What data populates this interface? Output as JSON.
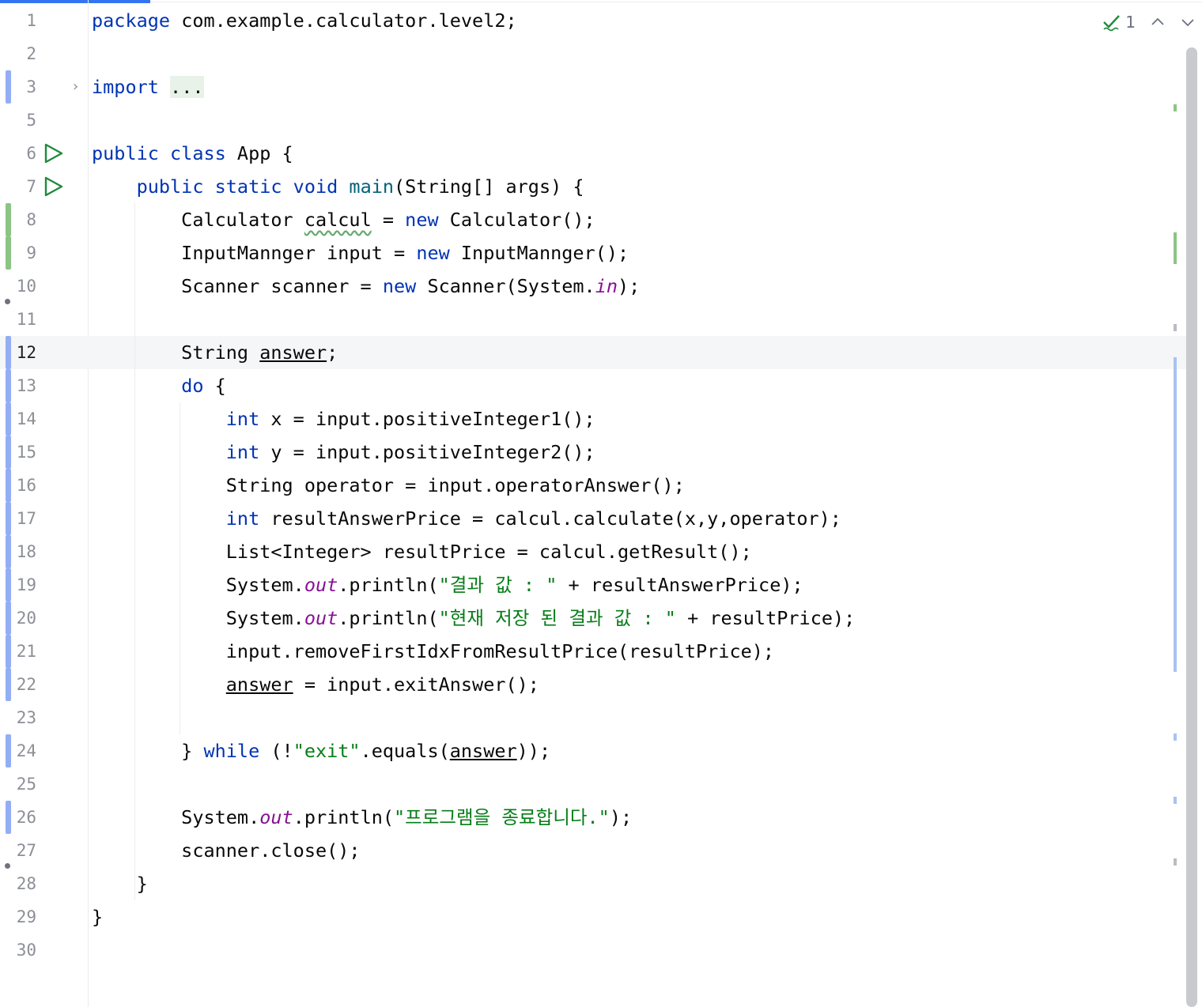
{
  "editor": {
    "lines": [
      {
        "n": "1",
        "tokens": [
          {
            "t": "package",
            "c": "kw"
          },
          {
            "t": " com.example.calculator.level2;",
            "c": "pl"
          }
        ]
      },
      {
        "n": "2",
        "tokens": []
      },
      {
        "n": "3",
        "tokens": [
          {
            "t": "import",
            "c": "kw"
          },
          {
            "t": " ",
            "c": "pl"
          },
          {
            "t": "...",
            "c": "fold"
          }
        ]
      },
      {
        "n": "5",
        "tokens": []
      },
      {
        "n": "6",
        "tokens": [
          {
            "t": "public class",
            "c": "kw"
          },
          {
            "t": " App {",
            "c": "pl"
          }
        ]
      },
      {
        "n": "7",
        "tokens": [
          {
            "t": "    "
          },
          {
            "t": "public static void",
            "c": "kw"
          },
          {
            "t": " "
          },
          {
            "t": "main",
            "c": "fn"
          },
          {
            "t": "(String[] args) {"
          }
        ]
      },
      {
        "n": "8",
        "tokens": [
          {
            "t": "        Calculator "
          },
          {
            "t": "calcul",
            "c": "warn"
          },
          {
            "t": " = "
          },
          {
            "t": "new",
            "c": "kw"
          },
          {
            "t": " Calculator();"
          }
        ]
      },
      {
        "n": "9",
        "tokens": [
          {
            "t": "        InputMannger input = "
          },
          {
            "t": "new",
            "c": "kw"
          },
          {
            "t": " InputMannger();"
          }
        ]
      },
      {
        "n": "10",
        "tokens": [
          {
            "t": "        Scanner scanner = "
          },
          {
            "t": "new",
            "c": "kw"
          },
          {
            "t": " Scanner(System."
          },
          {
            "t": "in",
            "c": "st"
          },
          {
            "t": ");"
          }
        ]
      },
      {
        "n": "11",
        "tokens": []
      },
      {
        "n": "12",
        "tokens": [
          {
            "t": "        String "
          },
          {
            "t": "answer",
            "c": "und"
          },
          {
            "t": ";"
          }
        ]
      },
      {
        "n": "13",
        "tokens": [
          {
            "t": "        "
          },
          {
            "t": "do",
            "c": "kw"
          },
          {
            "t": " {"
          }
        ]
      },
      {
        "n": "14",
        "tokens": [
          {
            "t": "            "
          },
          {
            "t": "int",
            "c": "kw"
          },
          {
            "t": " x = input.positiveInteger1();"
          }
        ]
      },
      {
        "n": "15",
        "tokens": [
          {
            "t": "            "
          },
          {
            "t": "int",
            "c": "kw"
          },
          {
            "t": " y = input.positiveInteger2();"
          }
        ]
      },
      {
        "n": "16",
        "tokens": [
          {
            "t": "            String operator = input.operatorAnswer();"
          }
        ]
      },
      {
        "n": "17",
        "tokens": [
          {
            "t": "            "
          },
          {
            "t": "int",
            "c": "kw"
          },
          {
            "t": " resultAnswerPrice = calcul.calculate(x,y,operator);"
          }
        ]
      },
      {
        "n": "18",
        "tokens": [
          {
            "t": "            List<Integer> resultPrice = calcul.getResult();"
          }
        ]
      },
      {
        "n": "19",
        "tokens": [
          {
            "t": "            System."
          },
          {
            "t": "out",
            "c": "st"
          },
          {
            "t": ".println("
          },
          {
            "t": "\"결과 값 : \"",
            "c": "str"
          },
          {
            "t": " + resultAnswerPrice);"
          }
        ]
      },
      {
        "n": "20",
        "tokens": [
          {
            "t": "            System."
          },
          {
            "t": "out",
            "c": "st"
          },
          {
            "t": ".println("
          },
          {
            "t": "\"현재 저장 된 결과 값 : \"",
            "c": "str"
          },
          {
            "t": " + resultPrice);"
          }
        ]
      },
      {
        "n": "21",
        "tokens": [
          {
            "t": "            input.removeFirstIdxFromResultPrice(resultPrice);"
          }
        ]
      },
      {
        "n": "22",
        "tokens": [
          {
            "t": "            "
          },
          {
            "t": "answer",
            "c": "und"
          },
          {
            "t": " = input.exitAnswer();"
          }
        ]
      },
      {
        "n": "23",
        "tokens": []
      },
      {
        "n": "24",
        "tokens": [
          {
            "t": "        } "
          },
          {
            "t": "while",
            "c": "kw"
          },
          {
            "t": " (!"
          },
          {
            "t": "\"exit\"",
            "c": "str"
          },
          {
            "t": ".equals("
          },
          {
            "t": "answer",
            "c": "und"
          },
          {
            "t": "));"
          }
        ]
      },
      {
        "n": "25",
        "tokens": []
      },
      {
        "n": "26",
        "tokens": [
          {
            "t": "        System."
          },
          {
            "t": "out",
            "c": "st"
          },
          {
            "t": ".println("
          },
          {
            "t": "\"프로그램을 종료합니다.\"",
            "c": "str"
          },
          {
            "t": ");"
          }
        ]
      },
      {
        "n": "27",
        "tokens": [
          {
            "t": "        scanner.close();"
          }
        ]
      },
      {
        "n": "28",
        "tokens": [
          {
            "t": "    }"
          }
        ]
      },
      {
        "n": "29",
        "tokens": [
          {
            "t": "}"
          }
        ]
      },
      {
        "n": "30",
        "tokens": []
      }
    ],
    "current_line": "12",
    "gutter_marks": {
      "changed_blue": [
        "3",
        "12",
        "13",
        "14",
        "15",
        "16",
        "17",
        "18",
        "19",
        "20",
        "21",
        "22",
        "24",
        "26"
      ],
      "changed_green": [
        "8",
        "9"
      ],
      "bullets": [
        "10",
        "27"
      ],
      "fold": [
        "3"
      ],
      "run": [
        "6",
        "7"
      ]
    }
  },
  "inspection": {
    "count": "1",
    "icon": "check-icon",
    "up_icon": "chevron-up-icon",
    "down_icon": "chevron-down-icon"
  },
  "colors": {
    "keyword": "#0033b3",
    "string": "#067d17",
    "static": "#871094",
    "method": "#00627a",
    "accent": "#3574f0",
    "change_blue": "#94aef5",
    "change_green": "#8bc485"
  }
}
